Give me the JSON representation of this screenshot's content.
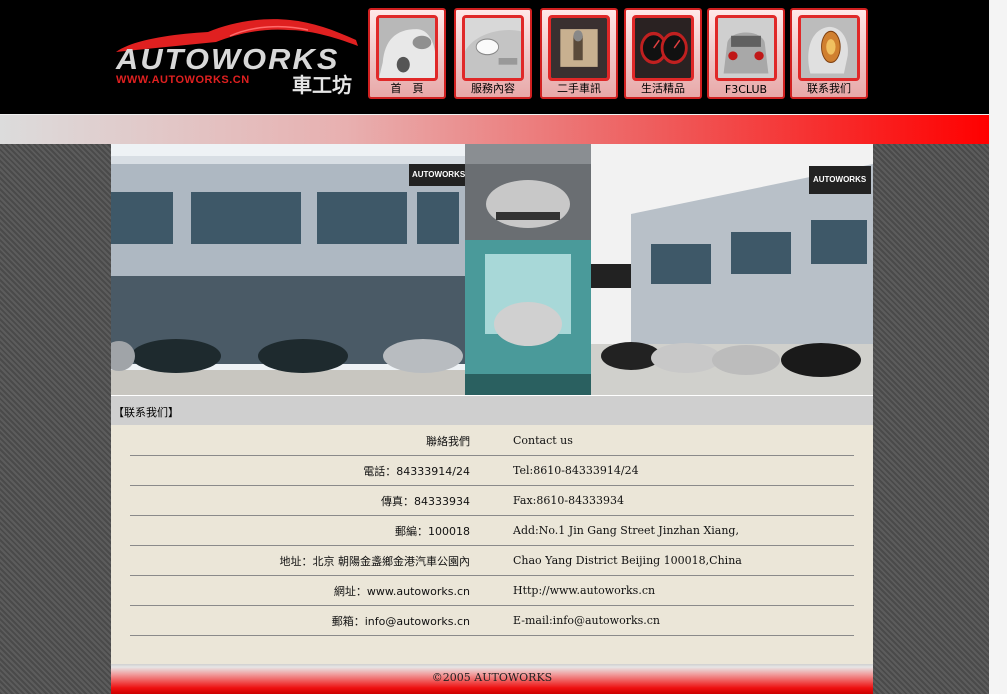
{
  "header": {
    "logo": {
      "name": "AUTOWORKS",
      "url": "WWW.AUTOWORKS.CN",
      "cn_name": "車工坊"
    },
    "nav": [
      {
        "label": "首　頁",
        "icon": "car-front-icon"
      },
      {
        "label": "服務內容",
        "icon": "headlight-icon"
      },
      {
        "label": "二手車訊",
        "icon": "gear-shift-icon"
      },
      {
        "label": "生活精品",
        "icon": "gauges-icon"
      },
      {
        "label": "F3CLUB",
        "icon": "car-rear-icon"
      },
      {
        "label": "联系我们",
        "icon": "taillight-icon"
      }
    ]
  },
  "main": {
    "section_title": "【联系我们】",
    "contact_rows": [
      {
        "left": "聯絡我們",
        "right": "Contact us"
      },
      {
        "left": "電話：84333914/24",
        "right": "Tel:8610-84333914/24"
      },
      {
        "left": "傳真：84333934",
        "right": "Fax:8610-84333934"
      },
      {
        "left": "郵編：100018",
        "right": "Add:No.1 Jin Gang Street Jinzhan Xiang,"
      },
      {
        "left": "地址：北京 朝陽金盞鄉金港汽車公園內",
        "right": "Chao Yang District Beijing 100018,China"
      },
      {
        "left": "網址：www.autoworks.cn",
        "right": "Http://www.autoworks.cn"
      },
      {
        "left": "郵箱：info@autoworks.cn",
        "right": "E-mail:info@autoworks.cn"
      }
    ]
  },
  "hero": {
    "sign_text": "AUTOWORKS"
  },
  "footer": {
    "copyright": "©2005 AUTOWORKS"
  },
  "colors": {
    "accent_red": "#e02020",
    "panel_bg": "#ebe6d8",
    "header_bg": "#000000"
  }
}
